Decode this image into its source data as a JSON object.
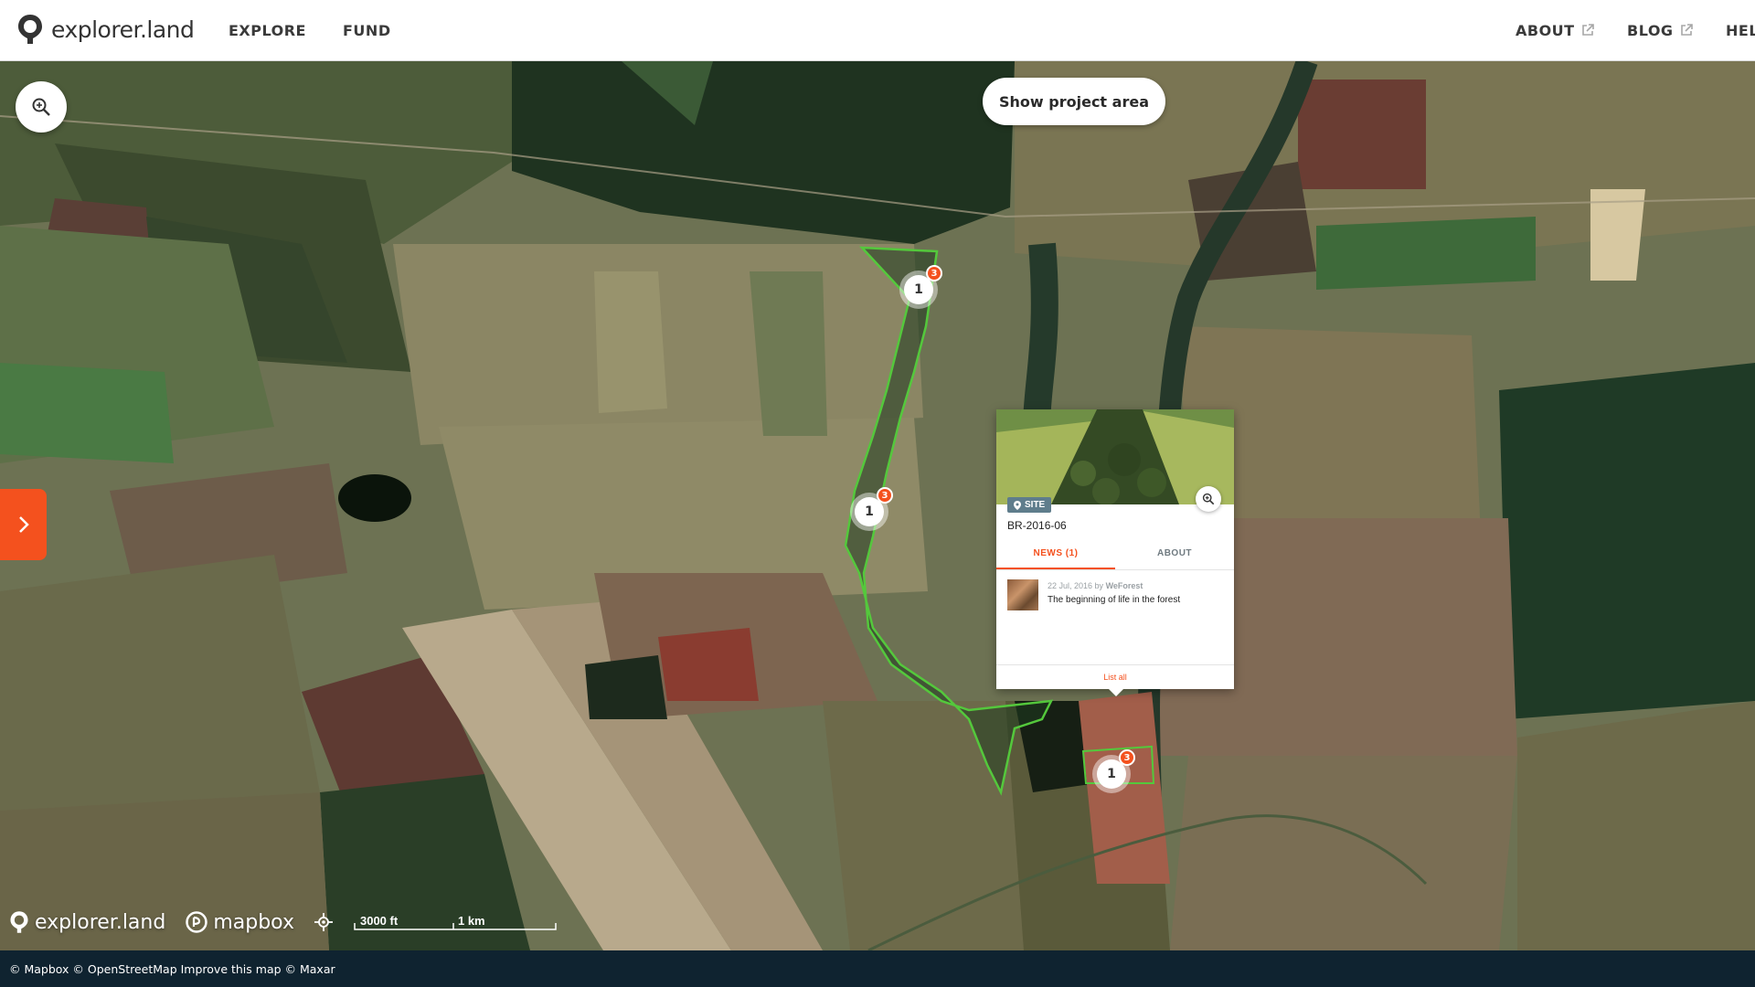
{
  "brand": {
    "name": "explorer.land",
    "accent": "#f4511e"
  },
  "header": {
    "nav_left": [
      "EXPLORE",
      "FUND"
    ],
    "about_label": "ABOUT",
    "blog_label": "BLOG",
    "help_label": "HEL"
  },
  "map": {
    "show_area_label": "Show project area",
    "markers": [
      {
        "count": "1",
        "badge": "3"
      },
      {
        "count": "1",
        "badge": "3"
      },
      {
        "count": "1",
        "badge": "3"
      }
    ],
    "popup": {
      "tag": "SITE",
      "site_name": "BR-2016-06",
      "tabs": [
        "NEWS (1)",
        "ABOUT"
      ],
      "news": {
        "date": "22 Jul, 2016 by",
        "author": "WeForest",
        "title": "The beginning of life in the forest"
      },
      "list_all": "List all"
    },
    "footer": {
      "brand_logo": "explorer.land",
      "mapbox_logo": "mapbox",
      "scale_ft": "3000 ft",
      "scale_km": "1 km"
    }
  },
  "attribution": "© Mapbox © OpenStreetMap Improve this map © Maxar"
}
